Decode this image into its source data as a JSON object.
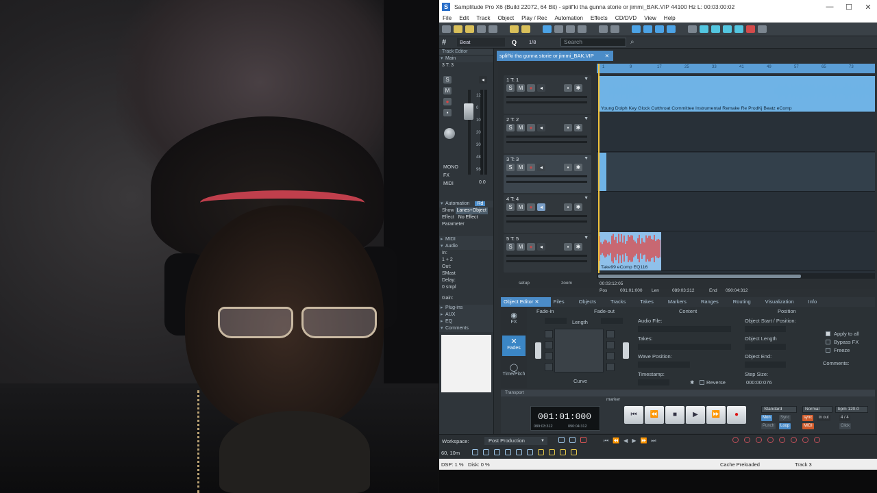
{
  "window": {
    "title": "Samplitude Pro X6 (Build 22072, 64 Bit)  -  splif'ki tha gunna storie or jimmi_BAK.VIP   44100 Hz L: 00:03:00:02",
    "controls": [
      "—",
      "☐",
      "✕"
    ]
  },
  "menu": [
    "File",
    "Edit",
    "Track",
    "Object",
    "Play / Rec",
    "Automation",
    "Effects",
    "CD/DVD",
    "View",
    "Help"
  ],
  "beatbar": {
    "grid": "Beat",
    "quantize": "Q",
    "fraction": "1/8",
    "search_placeholder": "Search"
  },
  "inspector": {
    "header": "Track Editor",
    "main": "Main",
    "track_sel": "3   T: 3",
    "scale": [
      "12",
      "0",
      "10",
      "20",
      "30",
      "48",
      "96",
      "0.0"
    ],
    "buttons": {
      "solo": "S",
      "mute": "M",
      "mono": "MONO",
      "fx": "FX",
      "midi": "MIDI"
    },
    "automation": {
      "title": "Automation",
      "mode": "Rd",
      "show_lbl": "Show",
      "show_val": "Lanes+Object",
      "effect_lbl": "Effect",
      "effect_val": "No Effect",
      "param_lbl": "Parameter"
    },
    "midi": "MIDI",
    "audio": {
      "title": "Audio",
      "in_lbl": "In:",
      "in_val": "1 + 2",
      "out_lbl": "Out:",
      "out_val": "SMast",
      "delay_lbl": "Delay:",
      "delay_val": "0 smpl",
      "gain_lbl": "Gain:"
    },
    "plugins": "Plug-ins",
    "aux": "AUX",
    "eq": "EQ",
    "comments": "Comments"
  },
  "editor_tab": {
    "label": "splif'ki tha gunna storie or jimmi_BAK.VIP",
    "close": "✕"
  },
  "tracks": [
    {
      "num": "1",
      "name": "T: 1",
      "selected": false,
      "monitor": false
    },
    {
      "num": "2",
      "name": "T: 2",
      "selected": false,
      "monitor": false
    },
    {
      "num": "3",
      "name": "T: 3",
      "selected": true,
      "monitor": false
    },
    {
      "num": "4",
      "name": "T: 4",
      "selected": false,
      "monitor": true
    },
    {
      "num": "5",
      "name": "T: 5",
      "selected": false,
      "monitor": false
    }
  ],
  "track_footer": {
    "setup": "setup",
    "zoom": "zoom"
  },
  "ruler_ticks": [
    "1",
    "9",
    "17",
    "25",
    "33",
    "41",
    "49",
    "57",
    "65",
    "73"
  ],
  "objects": [
    {
      "track": 1,
      "name": "Young Dolph  Key Glock  Cutthroat Committee Instrumental Remake Re ProdKj Beatz  eComp",
      "color": "#6fb3e6"
    },
    {
      "track": 3,
      "name": "",
      "color": "#6fb3e6"
    },
    {
      "track": 5,
      "name": "Take99  eComp EQ116",
      "color": "#e0423f"
    }
  ],
  "position": {
    "time": "00:03:12:05",
    "pos_lbl": "Pos",
    "pos": "001:01:000",
    "len_lbl": "Len",
    "len": "089:03:312",
    "end_lbl": "End",
    "end": "090:04:312"
  },
  "object_editor": {
    "tabs": [
      "Object Editor",
      "Files",
      "Objects",
      "Tracks",
      "Takes",
      "Markers",
      "Ranges",
      "Routing",
      "Visualization",
      "Info"
    ],
    "side": [
      "FX",
      "Fades",
      "Time/Pitch"
    ],
    "fades": {
      "fade_in": "Fade-in",
      "fade_out": "Fade-out",
      "length": "Length",
      "curve": "Curve"
    },
    "content": {
      "header": "Content",
      "audio_file": "Audio File:",
      "takes": "Takes:",
      "wave_position": "Wave Position:",
      "timestamp": "Timestamp:",
      "reverse": "Reverse"
    },
    "position": {
      "header": "Position",
      "start": "Object Start / Position:",
      "length": "Object Length",
      "end": "Object End:",
      "step": "Step Size:",
      "step_val": "000:00:076"
    },
    "options": {
      "apply_all": "Apply to all",
      "bypass_fx": "Bypass FX",
      "freeze": "Freeze",
      "comments": "Comments:"
    }
  },
  "transport": {
    "header": "Transport",
    "marker": "marker",
    "time": "001:01:000",
    "sub_time_a": "089:03:312",
    "sub_time_b": "090:04:312",
    "standard": "Standard",
    "mon": "Mon",
    "sync": "Sync",
    "punch": "Punch",
    "loop": "Loop",
    "normal": "Normal",
    "bpm": "bpm 120.0",
    "sig": "4 / 4",
    "click": "Click",
    "midi": "MIDI",
    "sync_label": "sync",
    "in_out": "in out"
  },
  "workspace": {
    "label": "Workspace:",
    "value": "Post Production"
  },
  "iconbar": {
    "label": "60, 10m"
  },
  "status": {
    "dsp": "DSP: 1 %",
    "disk": "Disk:  0 %",
    "cache": "Cache Preloaded",
    "track": "Track 3"
  }
}
